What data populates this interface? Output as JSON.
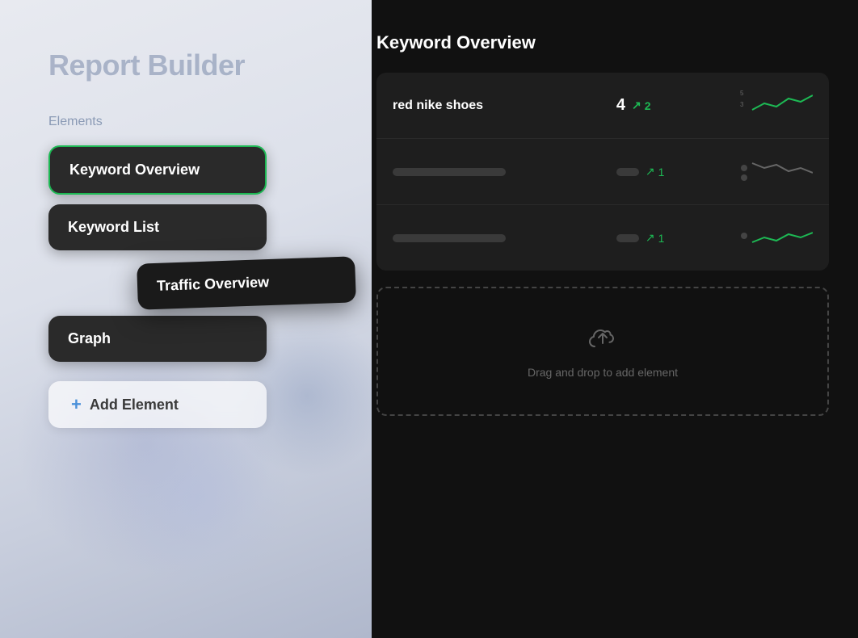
{
  "left_panel": {
    "title": "Report Builder",
    "elements_label": "Elements",
    "items": [
      {
        "id": "keyword-overview",
        "label": "Keyword Overview",
        "variant": "bordered"
      },
      {
        "id": "keyword-list",
        "label": "Keyword List",
        "variant": "normal"
      },
      {
        "id": "traffic-overview",
        "label": "Traffic Overview",
        "variant": "dragging"
      },
      {
        "id": "graph",
        "label": "Graph",
        "variant": "normal"
      }
    ],
    "add_button": {
      "label": "Add Element",
      "icon": "plus"
    }
  },
  "right_panel": {
    "title": "Keyword Overview",
    "table": {
      "rows": [
        {
          "keyword": "red nike shoes",
          "rank": "4",
          "change": "2",
          "chart_type": "line_up"
        },
        {
          "keyword": "",
          "rank": "",
          "change": "1",
          "chart_type": "line_down"
        },
        {
          "keyword": "",
          "rank": "",
          "change": "1",
          "chart_type": "line_up_small"
        }
      ]
    },
    "drop_zone": {
      "icon": "upload-cloud",
      "text": "Drag and drop\nto add element"
    }
  },
  "colors": {
    "accent_green": "#1db954",
    "dark_bg": "#111111",
    "card_bg": "#1e1e1e",
    "border_green": "#1db954"
  }
}
